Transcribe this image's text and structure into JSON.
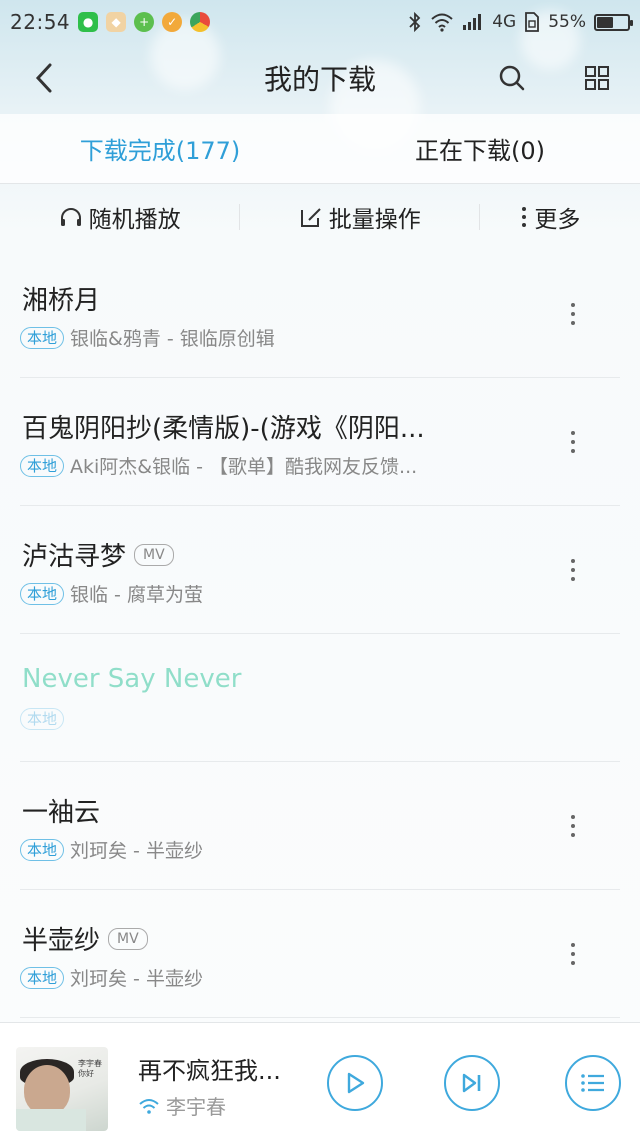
{
  "status_bar": {
    "time": "22:54",
    "network": "4G",
    "battery_percent": "55%",
    "battery_level": 0.55,
    "notification_icons": [
      "wechat-icon",
      "photo-app-icon",
      "plus-app-icon",
      "tool-app-icon",
      "browser-app-icon"
    ]
  },
  "header": {
    "title": "我的下载"
  },
  "tabs": [
    {
      "label": "下载完成(177)",
      "active": true
    },
    {
      "label": "正在下载(0)",
      "active": false
    }
  ],
  "actions": {
    "shuffle_label": "随机播放",
    "batch_label": "批量操作",
    "more_label": "更多"
  },
  "songs": [
    {
      "title": "湘桥月",
      "mv": false,
      "local_label": "本地",
      "meta": "银临&鸦青 - 银临原创辑"
    },
    {
      "title": "百鬼阴阳抄(柔情版)-(游戏《阴阳...",
      "mv": false,
      "local_label": "本地",
      "meta": "Aki阿杰&银临 - 【歌单】酷我网友反馈..."
    },
    {
      "title": "泸沽寻梦",
      "mv": true,
      "mv_label": "MV",
      "local_label": "本地",
      "meta": "银临 - 腐草为萤"
    },
    {
      "title": "Never Say Never",
      "mv": false,
      "local_label": "本地",
      "meta": ""
    },
    {
      "title": "一袖云",
      "mv": false,
      "local_label": "本地",
      "meta": "刘珂矣 - 半壶纱"
    },
    {
      "title": "半壶纱",
      "mv": true,
      "mv_label": "MV",
      "local_label": "本地",
      "meta": "刘珂矣 - 半壶纱"
    }
  ],
  "player": {
    "cover_text": "李宇春 你好",
    "title": "再不疯狂我...",
    "artist": "李宇春"
  },
  "colors": {
    "accent": "#2f9fd8",
    "control_ring": "#3fa9dd",
    "text_primary": "#222222",
    "text_secondary": "#888888"
  }
}
